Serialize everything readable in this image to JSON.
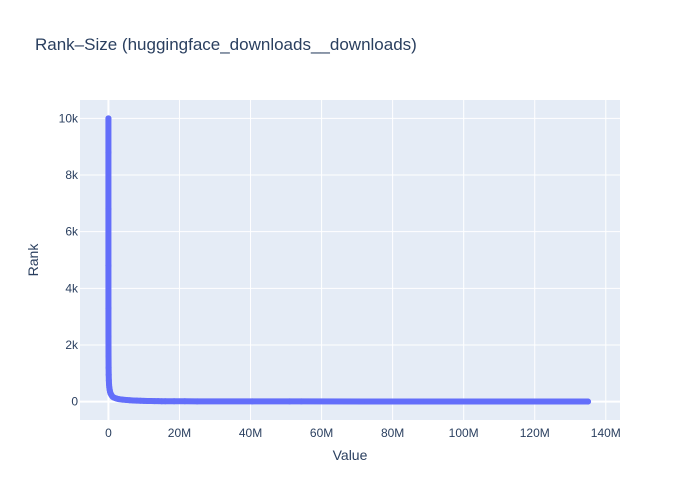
{
  "chart_data": {
    "type": "scatter",
    "title": "Rank–Size (huggingface_downloads__downloads)",
    "xlabel": "Value",
    "ylabel": "Rank",
    "xlim": [
      -8000000,
      144000000
    ],
    "ylim": [
      -650,
      10650
    ],
    "x_ticks": [
      {
        "value": 0,
        "label": "0"
      },
      {
        "value": 20000000,
        "label": "20M"
      },
      {
        "value": 40000000,
        "label": "40M"
      },
      {
        "value": 60000000,
        "label": "60M"
      },
      {
        "value": 80000000,
        "label": "80M"
      },
      {
        "value": 100000000,
        "label": "100M"
      },
      {
        "value": 120000000,
        "label": "120M"
      },
      {
        "value": 140000000,
        "label": "140M"
      }
    ],
    "y_ticks": [
      {
        "value": 0,
        "label": "0"
      },
      {
        "value": 2000,
        "label": "2k"
      },
      {
        "value": 4000,
        "label": "4k"
      },
      {
        "value": 6000,
        "label": "6k"
      },
      {
        "value": 8000,
        "label": "8k"
      },
      {
        "value": 10000,
        "label": "10k"
      }
    ],
    "grid": true,
    "legend": "none",
    "colors": {
      "marker": "#636efa",
      "plot_background": "#e5ecf6",
      "grid": "#ffffff",
      "text": "#2a3f5f"
    },
    "series": [
      {
        "x": [
          135000000,
          89000000,
          88000000,
          84500000,
          72800000,
          54300000,
          51000000,
          40500000,
          25000000,
          21500000,
          18500000,
          16000000,
          15000000,
          14000000,
          13000000,
          12000000,
          11000000,
          10000000,
          9000000,
          8000000,
          7000000,
          6000000,
          5000000,
          4000000,
          3000000,
          2500000,
          2000000,
          1500000,
          1200000,
          1000000,
          800000,
          600000,
          450000,
          350000,
          250000,
          180000,
          120000,
          80000,
          50000,
          30000,
          15000,
          8000,
          3000,
          1000,
          300,
          100
        ],
        "y": [
          1,
          2,
          3,
          4,
          5,
          6,
          7,
          8,
          9,
          10,
          11,
          12,
          13,
          15,
          17,
          19,
          22,
          25,
          29,
          34,
          40,
          48,
          58,
          70,
          85,
          100,
          120,
          145,
          170,
          200,
          240,
          290,
          350,
          420,
          500,
          600,
          750,
          950,
          1200,
          1600,
          2300,
          3300,
          4800,
          6800,
          8800,
          10000
        ]
      }
    ]
  }
}
